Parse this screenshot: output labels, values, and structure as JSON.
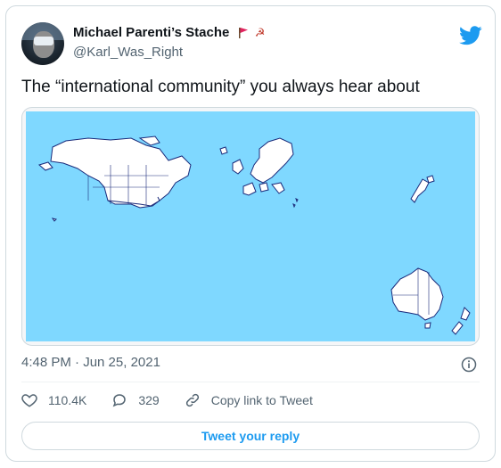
{
  "tweet": {
    "author_name": "Michael Parenti’s Stache",
    "author_emoji": "☭",
    "handle": "@Karl_Was_Right",
    "text": "The “international community” you always hear about",
    "timestamp": "4:48 PM · Jun 25, 2021"
  },
  "actions": {
    "likes": "110.4K",
    "replies": "329",
    "copy_link": "Copy link to Tweet"
  },
  "reply_button": "Tweet your reply",
  "colors": {
    "accent": "#1d9bf0",
    "map_ocean": "#7fd8ff",
    "flag": "#e0245e"
  },
  "icons": [
    "twitter-bird-icon",
    "flag-icon",
    "hammer-sickle-icon",
    "info-icon",
    "heart-icon",
    "reply-icon",
    "link-icon"
  ]
}
